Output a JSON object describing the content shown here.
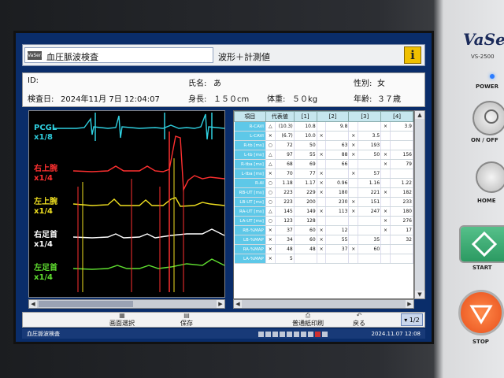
{
  "header": {
    "logo_text": "VaSera",
    "title": "血圧脈波検査",
    "subtitle": "波形＋計測値",
    "info_icon": "i"
  },
  "patient": {
    "id_label": "ID:",
    "name_label": "氏名:",
    "name_value": "あ",
    "sex_label": "性別:",
    "sex_value": "女",
    "exam_date_label": "検査日:",
    "exam_date_value": "2024年11月 7日 12:04:07",
    "height_label": "身長:",
    "height_value": "１５０cm",
    "weight_label": "体重:",
    "weight_value": "５０kg",
    "age_label": "年齢:",
    "age_value": "３７歳"
  },
  "waveform": {
    "channels": [
      {
        "name": "PCGL",
        "scale": "x1/8",
        "color": "#2fd0e0"
      },
      {
        "name": "右上腕",
        "scale": "x1/4",
        "color": "#ff3030"
      },
      {
        "name": "左上腕",
        "scale": "x1/4",
        "color": "#f0e020"
      },
      {
        "name": "右足首",
        "scale": "x1/4",
        "color": "#ffffff"
      },
      {
        "name": "左足首",
        "scale": "x1/4",
        "color": "#60e030"
      }
    ]
  },
  "table": {
    "headers": [
      "項目",
      "代表値",
      "[1]",
      "[2]",
      "[3]",
      "[4]"
    ],
    "rows": [
      {
        "label": "R-CAVI",
        "sym": "△",
        "rep": "(10.3)",
        "v1": "10.8",
        "s2": "",
        "v2": "9.8",
        "s3": "",
        "v3": "",
        "s4": "×",
        "v4": "3.9"
      },
      {
        "label": "L-CAVI",
        "sym": "×",
        "rep": "(6.7)",
        "v1": "10.0",
        "s2": "×",
        "v2": "",
        "s3": "×",
        "v3": "3.5",
        "s4": "",
        "v4": ""
      },
      {
        "label": "R-tb [ms]",
        "sym": "○",
        "rep": "72",
        "v1": "50",
        "s2": "",
        "v2": "63",
        "s3": "×",
        "v3": "193",
        "s4": "",
        "v4": ""
      },
      {
        "label": "L-tb [ms]",
        "sym": "△",
        "rep": "97",
        "v1": "55",
        "s2": "×",
        "v2": "88",
        "s3": "×",
        "v3": "50",
        "s4": "×",
        "v4": "156"
      },
      {
        "label": "R-tba [ms]",
        "sym": "△",
        "rep": "68",
        "v1": "69",
        "s2": "",
        "v2": "66",
        "s3": "",
        "v3": "",
        "s4": "×",
        "v4": "79"
      },
      {
        "label": "L-tba [ms]",
        "sym": "×",
        "rep": "70",
        "v1": "77",
        "s2": "×",
        "v2": "",
        "s3": "×",
        "v3": "57",
        "s4": "",
        "v4": ""
      },
      {
        "label": "R-AI",
        "sym": "○",
        "rep": "1.18",
        "v1": "1.17",
        "s2": "×",
        "v2": "0.96",
        "s3": "",
        "v3": "1.16",
        "s4": "",
        "v4": "1.22"
      },
      {
        "label": "RB-UT [ms]",
        "sym": "○",
        "rep": "223",
        "v1": "229",
        "s2": "×",
        "v2": "180",
        "s3": "",
        "v3": "221",
        "s4": "×",
        "v4": "182"
      },
      {
        "label": "LB-UT [ms]",
        "sym": "○",
        "rep": "223",
        "v1": "200",
        "s2": "",
        "v2": "230",
        "s3": "×",
        "v3": "151",
        "s4": "",
        "v4": "233"
      },
      {
        "label": "RA-UT [ms]",
        "sym": "△",
        "rep": "145",
        "v1": "149",
        "s2": "×",
        "v2": "113",
        "s3": "×",
        "v3": "247",
        "s4": "×",
        "v4": "180"
      },
      {
        "label": "LA-UT [ms]",
        "sym": "○",
        "rep": "123",
        "v1": "128",
        "s2": "",
        "v2": "",
        "s3": "",
        "v3": "",
        "s4": "×",
        "v4": "276"
      },
      {
        "label": "RB-%MAP",
        "sym": "×",
        "rep": "37",
        "v1": "60",
        "s2": "×",
        "v2": "12",
        "s3": "",
        "v3": "",
        "s4": "×",
        "v4": "17"
      },
      {
        "label": "LB-%MAP",
        "sym": "×",
        "rep": "34",
        "v1": "60",
        "s2": "×",
        "v2": "55",
        "s3": "",
        "v3": "35",
        "s4": "",
        "v4": "32"
      },
      {
        "label": "RA-%MAP",
        "sym": "×",
        "rep": "48",
        "v1": "48",
        "s2": "×",
        "v2": "37",
        "s3": "×",
        "v3": "60",
        "s4": "",
        "v4": ""
      },
      {
        "label": "LA-%MAP",
        "sym": "×",
        "rep": "5",
        "v1": "",
        "s2": "",
        "v2": "",
        "s3": "",
        "v3": "",
        "s4": "",
        "v4": ""
      }
    ]
  },
  "toolbar": {
    "screen_select": "画面選択",
    "save": "保存",
    "plain_print": "普通紙印刷",
    "back": "戻る",
    "page": "1/2"
  },
  "status": {
    "left": "血圧脈波検査",
    "datetime": "2024.11.07 12:08"
  },
  "device": {
    "brand": "VaSe",
    "model": "VS-2500",
    "power": "POWER",
    "onoff": "ON / OFF",
    "home": "HOME",
    "start": "START",
    "stop": "STOP"
  }
}
